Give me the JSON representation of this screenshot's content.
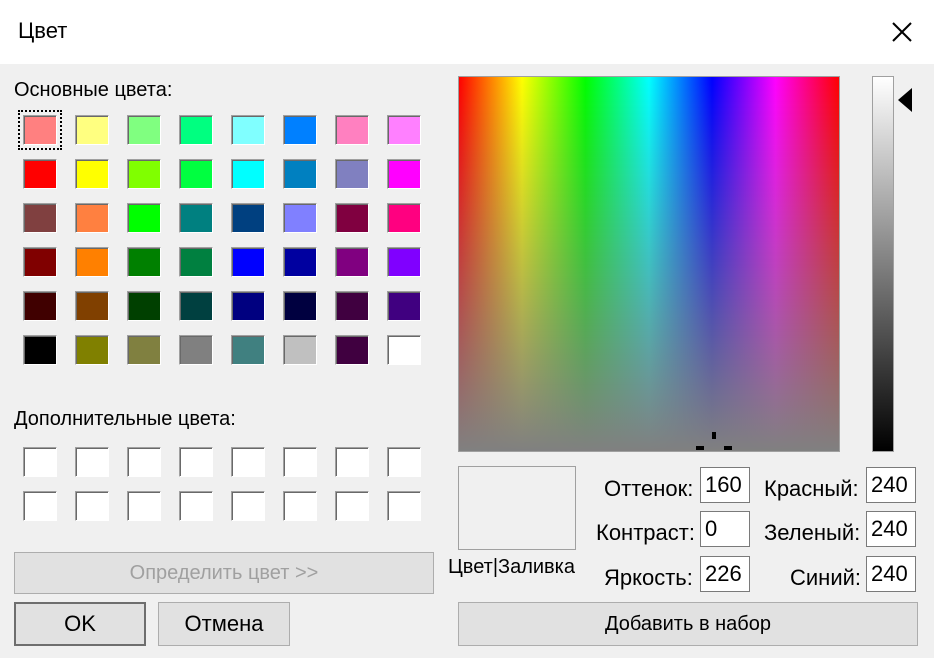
{
  "window": {
    "title": "Цвет",
    "close_icon": "close-icon"
  },
  "basic_colors": {
    "label": "Основные цвета:",
    "selected_index": 0,
    "colors": [
      "#ff8080",
      "#ffff80",
      "#80ff80",
      "#00ff80",
      "#80ffff",
      "#0080ff",
      "#ff80c0",
      "#ff80ff",
      "#ff0000",
      "#ffff00",
      "#80ff00",
      "#00ff40",
      "#00ffff",
      "#0080c0",
      "#8080c0",
      "#ff00ff",
      "#804040",
      "#ff8040",
      "#00ff00",
      "#008080",
      "#004080",
      "#8080ff",
      "#800040",
      "#ff0080",
      "#800000",
      "#ff8000",
      "#008000",
      "#008040",
      "#0000ff",
      "#0000a0",
      "#800080",
      "#8000ff",
      "#400000",
      "#804000",
      "#004000",
      "#004040",
      "#000080",
      "#000040",
      "#400040",
      "#400080",
      "#000000",
      "#808000",
      "#808040",
      "#808080",
      "#408080",
      "#c0c0c0",
      "#400040",
      "#ffffff"
    ]
  },
  "custom_colors": {
    "label": "Дополнительные цвета:",
    "colors": [
      "#ffffff",
      "#ffffff",
      "#ffffff",
      "#ffffff",
      "#ffffff",
      "#ffffff",
      "#ffffff",
      "#ffffff",
      "#ffffff",
      "#ffffff",
      "#ffffff",
      "#ffffff",
      "#ffffff",
      "#ffffff",
      "#ffffff",
      "#ffffff"
    ]
  },
  "buttons": {
    "define": "Определить цвет >>",
    "ok": "OK",
    "cancel": "Отмена",
    "add": "Добавить в набор"
  },
  "preview": {
    "label": "Цвет|Заливка",
    "color": "#f0f0f0"
  },
  "hsl": {
    "hue_label": "Оттенок:",
    "hue": "160",
    "sat_label": "Контраст:",
    "sat": "0",
    "lum_label": "Яркость:",
    "lum": "226"
  },
  "rgb": {
    "red_label": "Красный:",
    "red": "240",
    "green_label": "Зеленый:",
    "green": "240",
    "blue_label": "Синий:",
    "blue": "240"
  }
}
